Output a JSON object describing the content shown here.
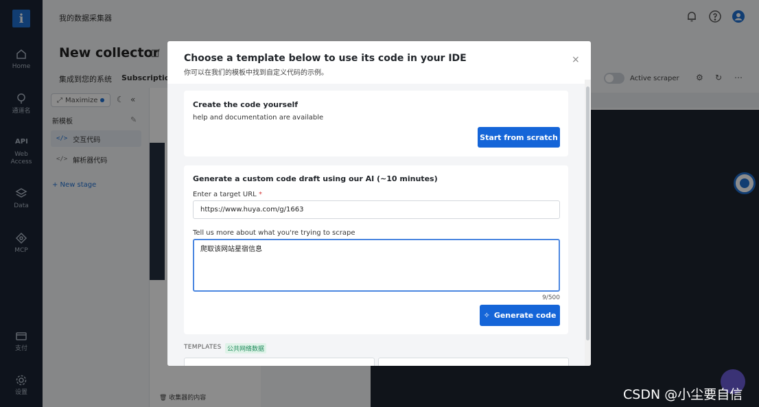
{
  "app": {
    "breadcrumb": "我的数据采集器",
    "page_title": "New collector"
  },
  "leftnav": {
    "logo": "i",
    "items": [
      {
        "label": "Home",
        "icon": "home-icon"
      },
      {
        "label": "通道名",
        "icon": "location-icon"
      },
      {
        "label": "Web Access",
        "icon": "api-icon",
        "badge": "API"
      },
      {
        "label": "Data",
        "icon": "layers-icon"
      },
      {
        "label": "MCP",
        "icon": "mcp-icon"
      },
      {
        "label": "支付",
        "icon": "card-icon"
      },
      {
        "label": "设置",
        "icon": "gear-icon"
      }
    ]
  },
  "subnav": {
    "items": [
      "集成到您的系统",
      "Subscription"
    ]
  },
  "toolbar": {
    "active_scraper": "Active scraper"
  },
  "leftpanel": {
    "maximize": "Maximize",
    "stage_title": "新模板",
    "items": [
      "交互代码",
      "解析器代码"
    ],
    "code_glyph": "</>",
    "new_stage": "+ New stage"
  },
  "editor": {
    "bottom_label": "🗑 收集器的内容"
  },
  "modal": {
    "title": "Choose a template below to use its code in your IDE",
    "subtitle": "你可以在我们的模板中找到自定义代码的示例。",
    "close": "×",
    "card1": {
      "heading": "Create the code yourself",
      "text": "help and documentation are available",
      "button": "Start from scratch"
    },
    "card2": {
      "heading": "Generate a custom code draft using our AI (~10 minutes)",
      "url_label": "Enter a target URL",
      "required_mark": "*",
      "url_value": "https://www.huya.com/g/1663",
      "desc_label": "Tell us more about what you're trying to scrape",
      "desc_value": "爬取该网站星宿信息",
      "counter": "9/500",
      "button": "Generate code",
      "button_icon": "✧"
    },
    "templates_label": "TEMPLATES",
    "templates_badge": "公共网络数据"
  },
  "watermark": "CSDN @小尘要自信",
  "colors": {
    "primary": "#1565d8",
    "nav_bg": "#1a2433",
    "focus": "#4a86e0"
  }
}
